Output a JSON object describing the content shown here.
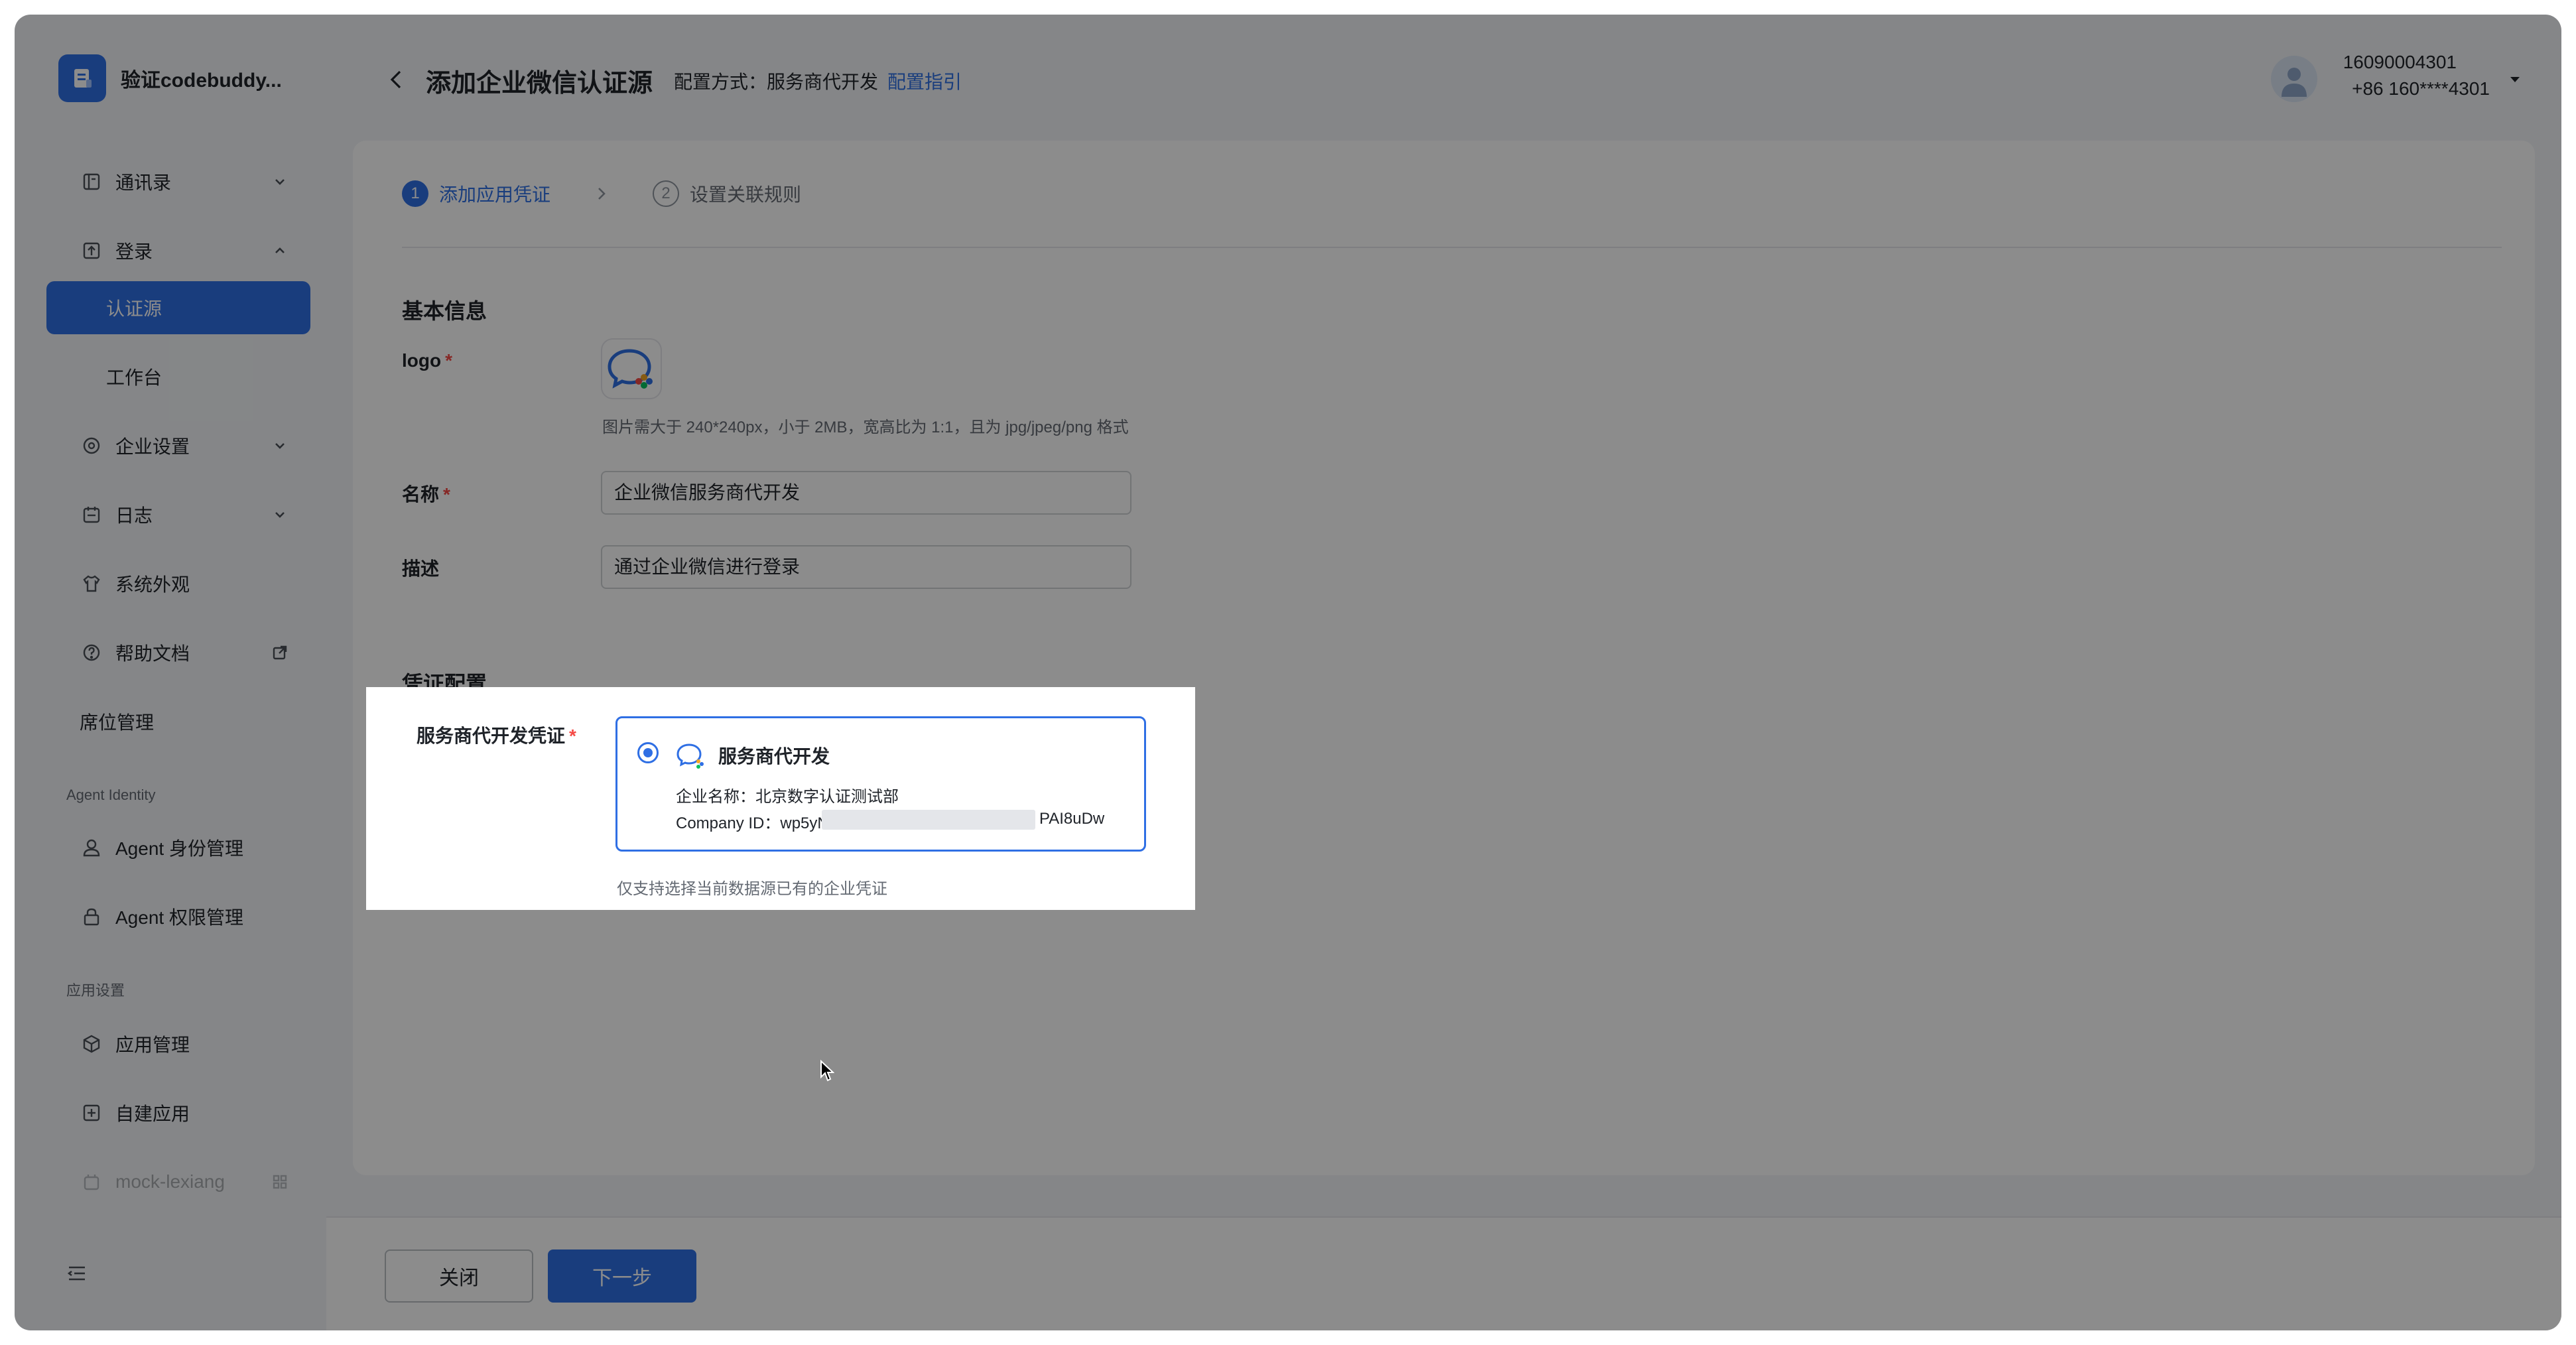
{
  "app": {
    "name": "验证codebuddy..."
  },
  "sidebar": {
    "items": [
      {
        "label": "通讯录"
      },
      {
        "label": "登录"
      },
      {
        "label": "认证源"
      },
      {
        "label": "工作台"
      },
      {
        "label": "企业设置"
      },
      {
        "label": "日志"
      },
      {
        "label": "系统外观"
      },
      {
        "label": "帮助文档"
      },
      {
        "label": "席位管理"
      }
    ],
    "section_agent": "Agent Identity",
    "agent_items": [
      {
        "label": "Agent 身份管理"
      },
      {
        "label": "Agent 权限管理"
      }
    ],
    "section_app": "应用设置",
    "app_items": [
      {
        "label": "应用管理"
      },
      {
        "label": "自建应用"
      },
      {
        "label": "mock-lexiang"
      }
    ]
  },
  "header": {
    "title": "添加企业微信认证源",
    "config_mode": "配置方式：服务商代开发",
    "config_guide": "配置指引",
    "user_name": "16090004301",
    "user_phone": "+86 160****4301"
  },
  "steps": [
    {
      "num": "1",
      "label": "添加应用凭证",
      "active": true
    },
    {
      "num": "2",
      "label": "设置关联规则",
      "active": false
    }
  ],
  "form": {
    "basic_title": "基本信息",
    "logo_label": "logo",
    "logo_hint": "图片需大于 240*240px，小于 2MB，宽高比为 1:1，且为 jpg/jpeg/png 格式",
    "name_label": "名称",
    "name_value": "企业微信服务商代开发",
    "desc_label": "描述",
    "desc_value": "通过企业微信进行登录",
    "cred_title": "凭证配置",
    "cred_label": "服务商代开发凭证",
    "required_mark": "*",
    "cred_option": {
      "title": "服务商代开发",
      "company_name": "企业名称：北京数字认证测试部",
      "company_id_prefix": "Company ID：wp5yN",
      "company_id_suffix": "PAI8uDw"
    },
    "cred_hint": "仅支持选择当前数据源已有的企业凭证"
  },
  "footer": {
    "close_label": "关闭",
    "next_label": "下一步"
  },
  "colors": {
    "accent": "#2f6fe4",
    "required": "#f54a45",
    "overlay": "rgba(0,0,0,0.45)"
  }
}
